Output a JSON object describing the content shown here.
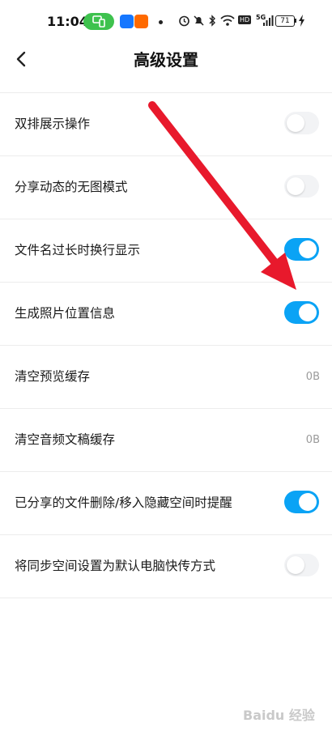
{
  "status_bar": {
    "time": "11:04",
    "network": "5G",
    "battery": "71",
    "hd_badge": "HD"
  },
  "header": {
    "title": "高级设置"
  },
  "settings": [
    {
      "label": "双排展示操作",
      "type": "toggle",
      "on": false
    },
    {
      "label": "分享动态的无图模式",
      "type": "toggle",
      "on": false
    },
    {
      "label": "文件名过长时换行显示",
      "type": "toggle",
      "on": true
    },
    {
      "label": "生成照片位置信息",
      "type": "toggle",
      "on": true
    },
    {
      "label": "清空预览缓存",
      "type": "value",
      "value": "0B"
    },
    {
      "label": "清空音频文稿缓存",
      "type": "value",
      "value": "0B"
    },
    {
      "label": "已分享的文件删除/移入隐藏空间时提醒",
      "type": "toggle",
      "on": true
    },
    {
      "label": "将同步空间设置为默认电脑快传方式",
      "type": "toggle",
      "on": false
    }
  ],
  "watermark": "Baidu 经验",
  "colors": {
    "toggle_on": "#0aa3f5",
    "toggle_off": "#f2f3f5",
    "arrow": "#e8192c",
    "cast_pill": "#3ec24e"
  }
}
